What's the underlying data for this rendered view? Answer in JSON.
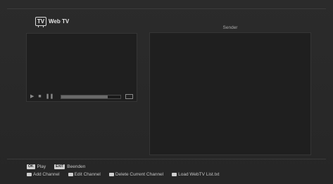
{
  "header": {
    "logo_text": "TV",
    "title": "Web TV"
  },
  "player": {
    "progress": 0.78,
    "controls": [
      "play-icon",
      "stop-icon",
      "pause-icon",
      "screen-icon"
    ]
  },
  "channel_list": {
    "header": "Sender"
  },
  "footer": {
    "ok_badge": "OK",
    "play_label": "Play",
    "exit_badge": "EXIT",
    "exit_label": "Beenden",
    "add_label": "Add Channel",
    "edit_label": "Edit Channel",
    "delete_label": "Delete Current Channel",
    "load_label": "Load WebTV List.txt"
  },
  "colors": {
    "background": "#2a2a2a",
    "pane": "#1f1f1f",
    "text": "#cfcfcf"
  }
}
